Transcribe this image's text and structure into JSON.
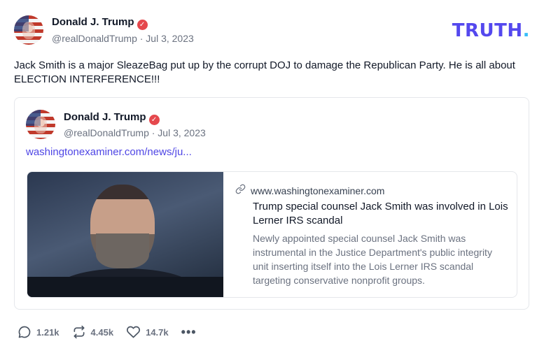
{
  "logo": {
    "text": "TRUTH",
    "dot": "."
  },
  "post": {
    "author_name": "Donald J. Trump",
    "author_handle_line": "@realDonaldTrump · Jul 3, 2023",
    "text": "Jack Smith is a major SleazeBag put up by the corrupt DOJ to damage the Republican Party. He is all about ELECTION INTERFERENCE!!!"
  },
  "quote": {
    "author_name": "Donald J. Trump",
    "author_handle_line": "@realDonaldTrump · Jul 3, 2023",
    "link_text": "washingtonexaminer.com/news/ju..."
  },
  "link_card": {
    "domain": "www.washingtonexaminer.com",
    "title": "Trump special counsel Jack Smith was involved in Lois Lerner IRS scandal",
    "description": "Newly appointed special counsel Jack Smith was instrumental in the Justice Department's public integrity unit inserting itself into the Lois Lerner IRS scandal targeting conservative nonprofit groups."
  },
  "actions": {
    "replies": "1.21k",
    "retruths": "4.45k",
    "likes": "14.7k",
    "more": "•••"
  },
  "colors": {
    "brand": "#5448ee",
    "brand_dot": "#38bdf8",
    "verified": "#e5484d",
    "link": "#4f46e5"
  },
  "icons": [
    "verified-badge-icon",
    "link-icon",
    "reply-icon",
    "retruth-icon",
    "heart-icon",
    "more-icon"
  ]
}
